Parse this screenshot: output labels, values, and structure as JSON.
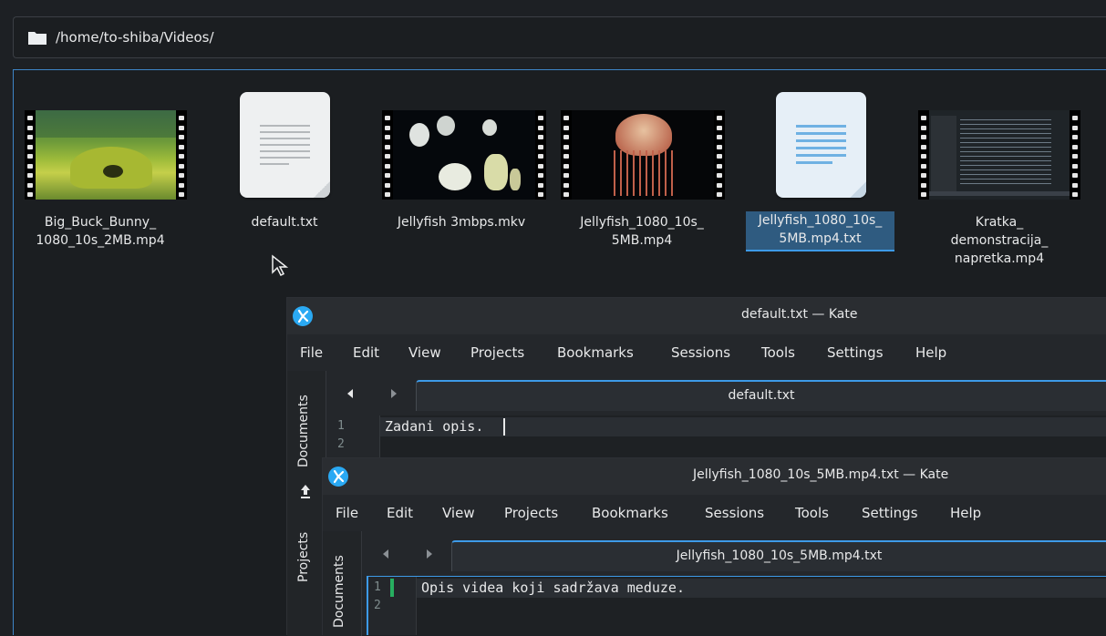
{
  "path_bar": {
    "path": "/home/to-shiba/Videos/"
  },
  "files": [
    {
      "name": "Big_Buck_Bunny_\n1080_10s_2MB.mp4",
      "kind": "video"
    },
    {
      "name": "default.txt",
      "kind": "text"
    },
    {
      "name": "Jellyfish 3mbps.mkv",
      "kind": "video"
    },
    {
      "name": "Jellyfish_1080_10s_\n5MB.mp4",
      "kind": "video"
    },
    {
      "name": "Jellyfish_1080_10s_\n5MB.mp4.txt",
      "kind": "text",
      "selected": true
    },
    {
      "name": "Kratka_\ndemonstracija_\nnapretka.mp4",
      "kind": "video"
    }
  ],
  "kate1": {
    "title": "default.txt — Kate",
    "menu": [
      "File",
      "Edit",
      "View",
      "Projects",
      "Bookmarks",
      "Sessions",
      "Tools",
      "Settings",
      "Help"
    ],
    "sidebar_tabs": [
      "Documents",
      "Projects"
    ],
    "tab_label": "default.txt",
    "line_numbers": [
      "1",
      "2"
    ],
    "lines": [
      "Zadani opis."
    ]
  },
  "kate2": {
    "title": "Jellyfish_1080_10s_5MB.mp4.txt — Kate",
    "menu": [
      "File",
      "Edit",
      "View",
      "Projects",
      "Bookmarks",
      "Sessions",
      "Tools",
      "Settings",
      "Help"
    ],
    "sidebar_tabs": [
      "Documents"
    ],
    "tab_label": "Jellyfish_1080_10s_5MB.mp4.txt",
    "line_numbers": [
      "1",
      "2"
    ],
    "lines": [
      "Opis videa koji sadržava meduze."
    ]
  },
  "colors": {
    "accent": "#3d9ae8",
    "selection": "#2f5b80",
    "kate_icon": "#2aa9f3"
  }
}
